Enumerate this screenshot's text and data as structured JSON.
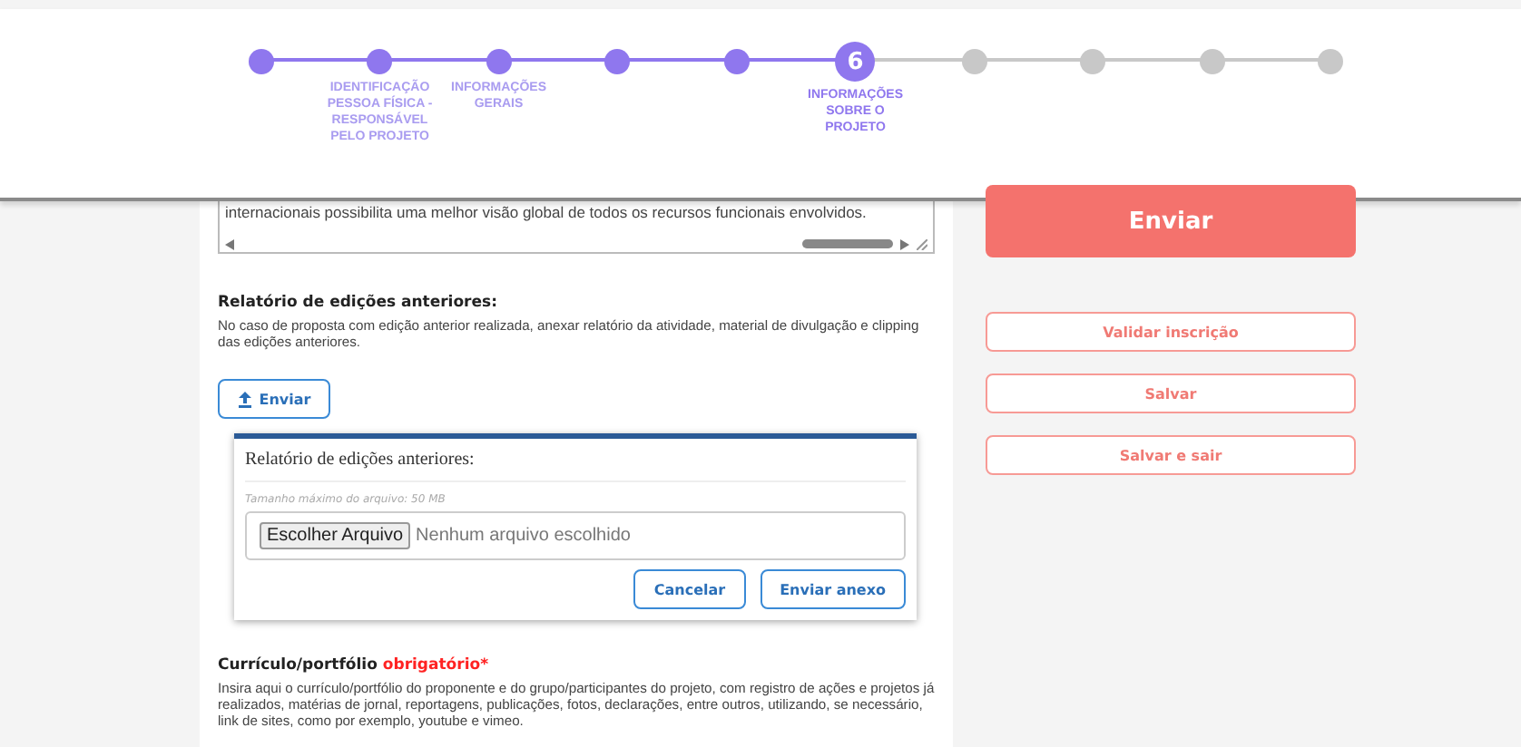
{
  "stepper": [
    {
      "completed": true,
      "selected": false
    },
    {
      "completed": true,
      "selected": false,
      "label": "IDENTIFICAÇÃO PESSOA FÍSICA - RESPONSÁVEL PELO PROJETO"
    },
    {
      "completed": true,
      "selected": false,
      "label": "INFORMAÇÕES GERAIS"
    },
    {
      "completed": true,
      "selected": false
    },
    {
      "completed": true,
      "selected": false
    },
    {
      "completed": true,
      "selected": true,
      "number": "6",
      "label": "INFORMAÇÕES SOBRE O PROJETO"
    },
    {
      "completed": false,
      "selected": false
    },
    {
      "completed": false,
      "selected": false
    },
    {
      "completed": false,
      "selected": false
    },
    {
      "completed": false,
      "selected": false
    }
  ],
  "textarea": {
    "value": "internacionais possibilita uma melhor visão global de todos os recursos funcionais envolvidos."
  },
  "report": {
    "heading": "Relatório de edições anteriores:",
    "description": "No caso de proposta com edição anterior realizada, anexar relatório da atividade, material de divulgação e clipping das edições anteriores.",
    "upload_button": "Enviar"
  },
  "upload_dialog": {
    "title": "Relatório de edições anteriores:",
    "hint": "Tamanho máximo do arquivo: 50 MB",
    "file_button": "Escolher Arquivo",
    "file_status": "Nenhum arquivo escolhido",
    "buttons": [
      "Cancelar",
      "Enviar anexo"
    ]
  },
  "portfolio": {
    "heading": "Currículo/portfólio",
    "required": "obrigatório*",
    "description": "Insira aqui o currículo/portfólio do proponente e do grupo/participantes do projeto, com registro de ações e projetos já realizados, matérias de jornal, reportagens, publicações, fotos, declarações, entre outros, utilizando, se necessário, link de sites, como por exemplo, youtube e vimeo."
  },
  "actions": [
    {
      "label": "Enviar",
      "kind": "primary"
    },
    {
      "label": "Validar inscrição",
      "kind": "outline"
    },
    {
      "label": "Salvar",
      "kind": "outline"
    },
    {
      "label": "Salvar e sair",
      "kind": "outline"
    }
  ]
}
